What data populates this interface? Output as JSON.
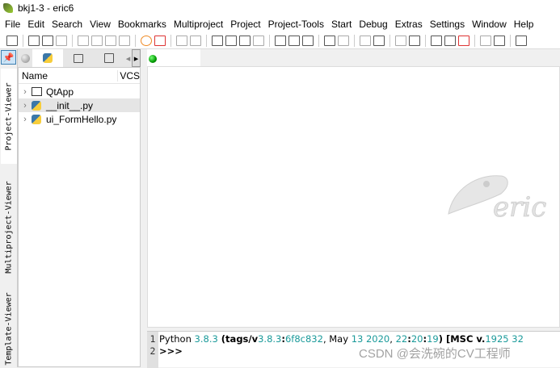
{
  "window": {
    "title": "bkj1-3 - eric6"
  },
  "menu": [
    "File",
    "Edit",
    "Search",
    "View",
    "Bookmarks",
    "Multiproject",
    "Project",
    "Project-Tools",
    "Start",
    "Debug",
    "Extras",
    "Settings",
    "Window",
    "Help"
  ],
  "sidebar_tabs": [
    "Project-Viewer",
    "Multiproject-Viewer",
    "Template-Viewer"
  ],
  "project_tree": {
    "columns": [
      "Name",
      "VCS"
    ],
    "items": [
      {
        "label": "QtApp",
        "type": "folder"
      },
      {
        "label": "__init__.py",
        "type": "python",
        "selected": true
      },
      {
        "label": "ui_FormHello.py",
        "type": "python"
      }
    ]
  },
  "shell": {
    "line_numbers": [
      "1",
      "2"
    ],
    "line1": {
      "a": "Python ",
      "b": "3.8.3",
      "c": " (tags/v",
      "d": "3.8.3",
      ":": ":",
      "e": "6f8c832",
      ",": ", May ",
      "f": "13 2020",
      ",2": ", ",
      "g": "22",
      ":2": ":",
      "h": "20",
      ":3": ":",
      "i": "19",
      ")": ") [MSC v.",
      "j": "1925 32"
    },
    "prompt": ">>>"
  },
  "logo_text": "eric",
  "watermark": "CSDN @会洗碗的CV工程师"
}
